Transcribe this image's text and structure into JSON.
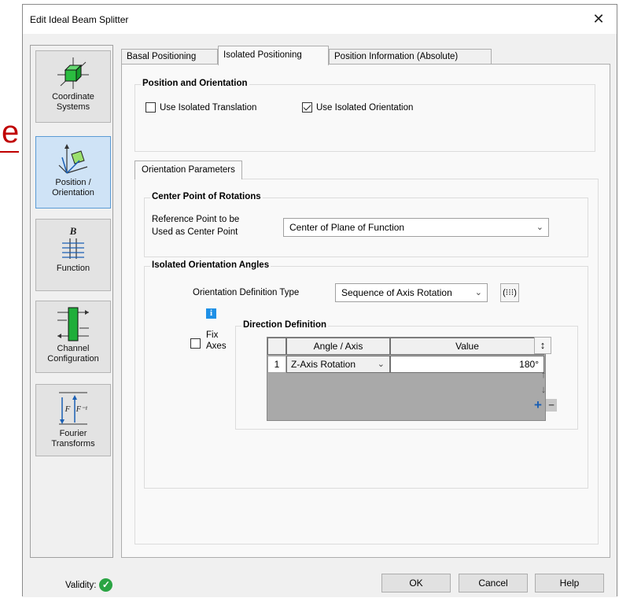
{
  "background": {
    "letter": "e"
  },
  "window": {
    "title": "Edit Ideal Beam Splitter",
    "close_symbol": "✕"
  },
  "sidebar": {
    "items": [
      {
        "label_line1": "Coordinate",
        "label_line2": "Systems",
        "icon": "coordinate-systems-icon",
        "active": false
      },
      {
        "label_line1": "Position /",
        "label_line2": "Orientation",
        "icon": "position-orientation-icon",
        "active": true
      },
      {
        "label_line1": "Function",
        "label_line2": "",
        "icon": "function-icon",
        "active": false
      },
      {
        "label_line1": "Channel",
        "label_line2": "Configuration",
        "icon": "channel-configuration-icon",
        "active": false
      },
      {
        "label_line1": "Fourier",
        "label_line2": "Transforms",
        "icon": "fourier-transforms-icon",
        "active": false
      }
    ]
  },
  "tabs": [
    {
      "label": "Basal Positioning",
      "active": false
    },
    {
      "label": "Isolated Positioning",
      "active": true
    },
    {
      "label": "Position Information (Absolute)",
      "active": false
    }
  ],
  "position_orientation": {
    "title": "Position and Orientation",
    "use_translation": {
      "label": "Use Isolated Translation",
      "checked": false
    },
    "use_orientation": {
      "label": "Use Isolated Orientation",
      "checked": true
    }
  },
  "orientation_parameters": {
    "tab_label": "Orientation Parameters",
    "center_point": {
      "title": "Center Point of Rotations",
      "ref_label_line1": "Reference Point to be",
      "ref_label_line2": "Used as Center Point",
      "ref_value": "Center of Plane of Function"
    },
    "angles": {
      "title": "Isolated Orientation Angles",
      "def_type_label": "Orientation Definition Type",
      "def_type_value": "Sequence of Axis Rotation",
      "matrix_btn": "(⁝⁝⁝)",
      "info_symbol": "i",
      "fix_axes_line1": "Fix",
      "fix_axes_line2": "Axes",
      "fix_axes_checked": false,
      "direction_title": "Direction Definition",
      "columns": [
        "Angle / Axis",
        "Value"
      ],
      "rows": [
        {
          "index": "1",
          "axis": "Z-Axis Rotation",
          "value": "180°"
        }
      ]
    }
  },
  "footer": {
    "validity_label": "Validity:",
    "validity_symbol": "✓",
    "ok_label": "OK",
    "cancel_label": "Cancel",
    "help_label": "Help"
  },
  "colors": {
    "accent_active": "#cfe3f6",
    "valid_green": "#2aa443",
    "info_blue": "#1e90e6",
    "function_green": "#1fae3a",
    "plus_blue": "#1a5fb4"
  }
}
